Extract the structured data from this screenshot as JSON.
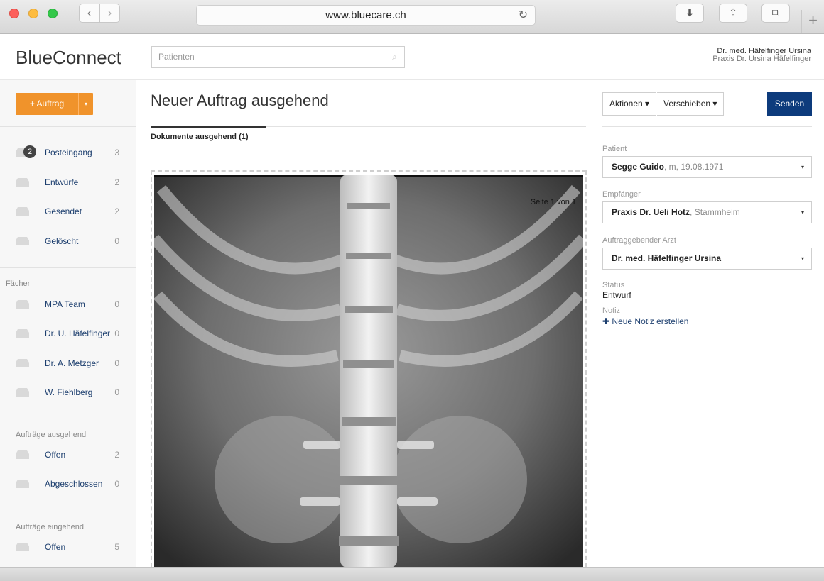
{
  "browser": {
    "url": "www.bluecare.ch",
    "back_glyph": "‹",
    "forward_glyph": "›",
    "reload_glyph": "↻",
    "download_glyph": "⬇",
    "share_glyph": "⇪",
    "tabs_glyph": "⧉",
    "new_tab_glyph": "+"
  },
  "header": {
    "logo": "BlueConnect",
    "search_placeholder": "Patienten",
    "search_icon": "⌕",
    "user_name": "Dr. med. Häfelfinger Ursina",
    "user_practice": "Praxis Dr. Ursina Häfelfinger"
  },
  "sidebar": {
    "new_order_label": "+ Auftrag",
    "new_order_caret": "▾",
    "inbox": [
      {
        "label": "Posteingang",
        "count": "3",
        "badge": "2"
      },
      {
        "label": "Entwürfe",
        "count": "2"
      },
      {
        "label": "Gesendet",
        "count": "2"
      },
      {
        "label": "Gelöscht",
        "count": "0"
      }
    ],
    "faecher_title": "Fächer",
    "faecher": [
      {
        "label": "MPA Team",
        "count": "0"
      },
      {
        "label": "Dr. U. Häfelfinger",
        "count": "0"
      },
      {
        "label": "Dr. A. Metzger",
        "count": "0"
      },
      {
        "label": "W. Fiehlberg",
        "count": "0"
      }
    ],
    "outgoing_title": "Aufträge ausgehend",
    "outgoing": [
      {
        "label": "Offen",
        "count": "2"
      },
      {
        "label": "Abgeschlossen",
        "count": "0"
      }
    ],
    "incoming_title": "Aufträge eingehend",
    "incoming": [
      {
        "label": "Offen",
        "count": "5"
      }
    ]
  },
  "main": {
    "title": "Neuer Auftrag ausgehend",
    "tab_label": "Dokumente ausgehend (1)",
    "page_indicator": "Seite 1 von 1"
  },
  "panel": {
    "actions_label": "Aktionen ▾",
    "move_label": "Verschieben ▾",
    "send_label": "Senden",
    "patient_label": "Patient",
    "patient_name": "Segge Guido",
    "patient_details": ", m, 19.08.1971",
    "recipient_label": "Empfänger",
    "recipient_name": "Praxis Dr. Ueli Hotz",
    "recipient_place": ", Stammheim",
    "doctor_label": "Auftraggebender Arzt",
    "doctor_name": "Dr. med. Häfelfinger Ursina",
    "status_label": "Status",
    "status_value": "Entwurf",
    "note_label": "Notiz",
    "note_plus": "✚",
    "note_link": "Neue Notiz erstellen",
    "select_caret": "▾"
  },
  "colors": {
    "accent": "#f0932b",
    "primary": "#0d3b7c",
    "link": "#1c3e6e"
  }
}
